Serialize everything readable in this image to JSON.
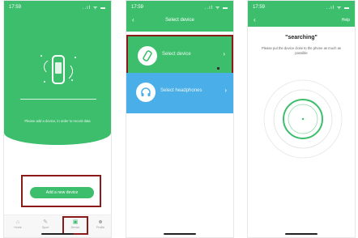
{
  "screen1": {
    "time": "17:59",
    "status_icons": "..ıl ᯤ ▬",
    "hint": "Please add a device, in order to record data",
    "add_button": "Add a new device",
    "tabs": [
      {
        "label": "Home",
        "icon": "⌂"
      },
      {
        "label": "Sport",
        "icon": "✎"
      },
      {
        "label": "Device",
        "icon": "▣"
      },
      {
        "label": "Profile",
        "icon": "☻"
      }
    ],
    "active_tab": "Device"
  },
  "screen2": {
    "time": "17:59",
    "status_icons": "..ıl ᯤ ▬",
    "title": "Select device",
    "options": [
      {
        "label": "Select device"
      },
      {
        "label": "Select headphones"
      }
    ]
  },
  "screen3": {
    "time": "17:59",
    "status_icons": "..ıl ᯤ ▬",
    "help": "Help",
    "title": "\"searching\"",
    "description": "Please put the device close to the phone as much as possible"
  },
  "colors": {
    "green": "#3dbe6c",
    "blue": "#4aaee8",
    "highlight": "#8b1a1a"
  }
}
